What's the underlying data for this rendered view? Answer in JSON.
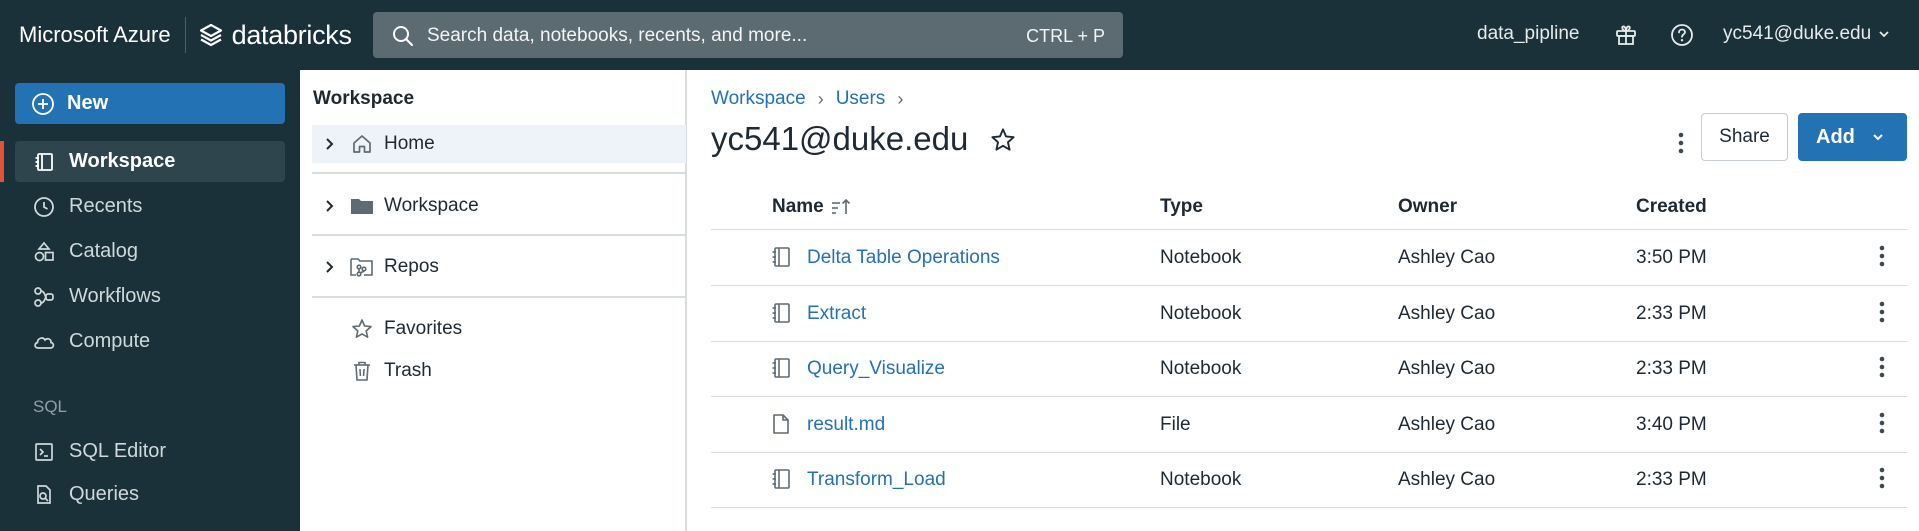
{
  "topbar": {
    "cloud": "Microsoft Azure",
    "product": "databricks",
    "search_placeholder": "Search data, notebooks, recents, and more...",
    "search_shortcut": "CTRL + P",
    "workspace_name": "data_pipline",
    "user": "yc541@duke.edu"
  },
  "sidebar": {
    "new_label": "New",
    "items": [
      {
        "label": "Workspace",
        "icon": "workspace-icon",
        "active": true
      },
      {
        "label": "Recents",
        "icon": "clock-icon"
      },
      {
        "label": "Catalog",
        "icon": "catalog-icon"
      },
      {
        "label": "Workflows",
        "icon": "workflows-icon"
      },
      {
        "label": "Compute",
        "icon": "cloud-icon"
      }
    ],
    "section_label": "SQL",
    "sql_items": [
      {
        "label": "SQL Editor",
        "icon": "sql-editor-icon"
      },
      {
        "label": "Queries",
        "icon": "queries-icon"
      }
    ],
    "active_color": "#e1523d"
  },
  "tree": {
    "title": "Workspace",
    "items": [
      {
        "label": "Home",
        "icon": "home-icon",
        "selected": true
      },
      {
        "label": "Workspace",
        "icon": "folder-icon"
      },
      {
        "label": "Repos",
        "icon": "repo-icon"
      },
      {
        "label": "Favorites",
        "icon": "star-icon"
      },
      {
        "label": "Trash",
        "icon": "trash-icon"
      }
    ]
  },
  "main": {
    "breadcrumb": [
      "Workspace",
      "Users"
    ],
    "title": "yc541@duke.edu",
    "share_label": "Share",
    "add_label": "Add",
    "columns": [
      "Name",
      "Type",
      "Owner",
      "Created"
    ],
    "rows": [
      {
        "name": "Delta Table Operations",
        "type": "Notebook",
        "owner": "Ashley Cao",
        "created": "3:50 PM",
        "icon": "notebook-icon"
      },
      {
        "name": "Extract",
        "type": "Notebook",
        "owner": "Ashley Cao",
        "created": "2:33 PM",
        "icon": "notebook-icon"
      },
      {
        "name": "Query_Visualize",
        "type": "Notebook",
        "owner": "Ashley Cao",
        "created": "2:33 PM",
        "icon": "notebook-icon"
      },
      {
        "name": "result.md",
        "type": "File",
        "owner": "Ashley Cao",
        "created": "3:40 PM",
        "icon": "file-icon"
      },
      {
        "name": "Transform_Load",
        "type": "Notebook",
        "owner": "Ashley Cao",
        "created": "2:33 PM",
        "icon": "notebook-icon"
      }
    ],
    "accent": "#2272b4"
  }
}
